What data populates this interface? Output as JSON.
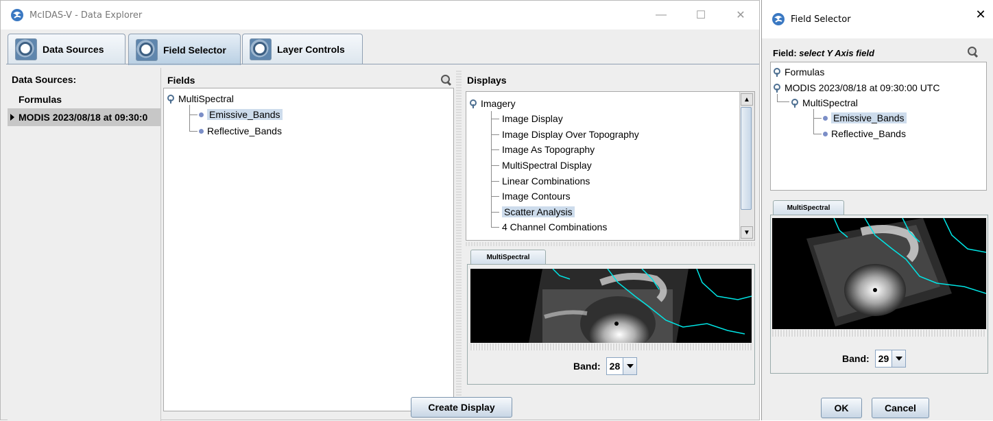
{
  "main_window": {
    "title": "McIDAS-V - Data Explorer",
    "controls": {
      "minimize": "—",
      "maximize": "☐",
      "close": "✕"
    },
    "tabs": [
      {
        "label": "Data Sources",
        "selected": false
      },
      {
        "label": "Field Selector",
        "selected": true
      },
      {
        "label": "Layer Controls",
        "selected": false
      }
    ],
    "data_sources": {
      "header": "Data Sources:",
      "items": [
        {
          "label": "Formulas",
          "selected": false
        },
        {
          "label": "MODIS 2023/08/18 at 09:30:0",
          "selected": true
        }
      ]
    },
    "fields": {
      "header": "Fields",
      "root": "MultiSpectral",
      "children": [
        {
          "label": "Emissive_Bands",
          "selected": true
        },
        {
          "label": "Reflective_Bands",
          "selected": false
        }
      ]
    },
    "displays": {
      "header": "Displays",
      "group": "Imagery",
      "items": [
        {
          "label": "Image Display",
          "selected": false
        },
        {
          "label": "Image Display Over Topography",
          "selected": false
        },
        {
          "label": "Image As Topography",
          "selected": false
        },
        {
          "label": "MultiSpectral Display",
          "selected": false
        },
        {
          "label": "Linear Combinations",
          "selected": false
        },
        {
          "label": "Image Contours",
          "selected": false
        },
        {
          "label": "Scatter Analysis",
          "selected": true
        },
        {
          "label": "4 Channel Combinations",
          "selected": false
        }
      ],
      "scroll_position": 0.0
    },
    "preview": {
      "tab_label": "MultiSpectral",
      "band_label": "Band:",
      "band_value": "28"
    },
    "create_button": "Create Display"
  },
  "field_selector_dialog": {
    "title": "Field Selector",
    "close": "✕",
    "prompt": "Field:",
    "prompt_emphasis": "select Y Axis field",
    "tree": {
      "formulas": "Formulas",
      "source": "MODIS 2023/08/18 at 09:30:00 UTC",
      "group": "MultiSpectral",
      "children": [
        {
          "label": "Emissive_Bands",
          "selected": true
        },
        {
          "label": "Reflective_Bands",
          "selected": false
        }
      ]
    },
    "preview": {
      "tab_label": "MultiSpectral",
      "band_label": "Band:",
      "band_value": "29"
    },
    "ok_button": "OK",
    "cancel_button": "Cancel"
  },
  "colors": {
    "selection": "#cddcec",
    "coastline": "#00e5e5",
    "tab_border": "#8f9fb2"
  }
}
